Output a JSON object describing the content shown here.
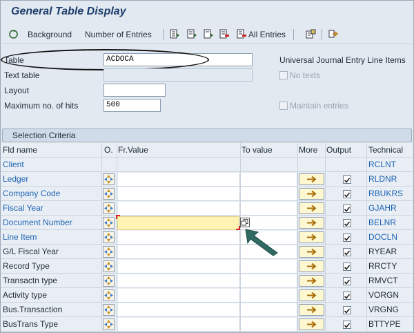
{
  "title": "General Table Display",
  "toolbar": {
    "background": "Background",
    "number_of_entries": "Number of Entries",
    "all_entries": "All Entries"
  },
  "form": {
    "table_label": "Table",
    "table_value": "ACDOCA",
    "table_desc": "Universal Journal Entry Line Items",
    "text_table_label": "Text table",
    "no_texts_label": "No texts",
    "layout_label": "Layout",
    "layout_value": "",
    "max_hits_label": "Maximum no. of hits",
    "max_hits_value": "500",
    "maintain_label": "Maintain entries"
  },
  "selection": {
    "header": "Selection Criteria",
    "columns": {
      "fld_name": "Fld name",
      "o": "O.",
      "fr_value": "Fr.Value",
      "to_value": "To value",
      "more": "More",
      "output": "Output",
      "technical": "Technical"
    },
    "rows": [
      {
        "field": "Client",
        "tech": "RCLNT"
      },
      {
        "field": "Ledger",
        "tech": "RLDNR"
      },
      {
        "field": "Company Code",
        "tech": "RBUKRS"
      },
      {
        "field": "Fiscal Year",
        "tech": "GJAHR"
      },
      {
        "field": "Document Number",
        "tech": "BELNR"
      },
      {
        "field": "Line Item",
        "tech": "DOCLN"
      },
      {
        "field": "G/L Fiscal Year",
        "tech": "RYEAR"
      },
      {
        "field": "Record Type",
        "tech": "RRCTY"
      },
      {
        "field": "Transactn type",
        "tech": "RMVCT"
      },
      {
        "field": "Activity type",
        "tech": "VORGN"
      },
      {
        "field": "Bus.Transaction",
        "tech": "VRGNG"
      },
      {
        "field": "BusTrans Type",
        "tech": "BTTYPE"
      }
    ]
  }
}
